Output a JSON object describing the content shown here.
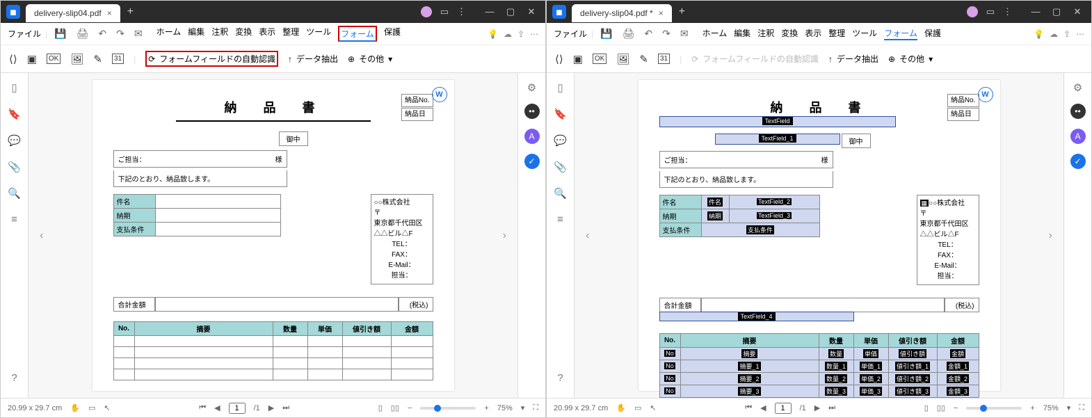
{
  "leftWindow": {
    "tab": {
      "title": "delivery-slip04.pdf"
    },
    "menubar": {
      "file": "ファイル",
      "items": [
        "ホーム",
        "編集",
        "注釈",
        "変換",
        "表示",
        "整理",
        "ツール"
      ],
      "form": "フォーム",
      "protect": "保護"
    },
    "toolbar": {
      "autorec": "フォームフィールドの自動認識",
      "extract": "データ抽出",
      "other": "その他"
    },
    "doc": {
      "title": "納　品　書",
      "nouhin_no": "納品No.",
      "nouhin_date": "納品日",
      "onchu": "御中",
      "tantou": "ご担当：",
      "sama": "様",
      "note": "下記のとおり、納品致します。",
      "kenmei": "件名",
      "nouki": "納期",
      "shiharai": "支払条件",
      "company": "○○株式会社",
      "postal": "〒",
      "addr1": "東京都千代田区",
      "addr2": "△△ビル△F",
      "tel": "TEL：",
      "fax": "FAX：",
      "email": "E-Mail：",
      "tantou2": "担当：",
      "total_label": "合計金額",
      "tax": "(税込)",
      "cols": {
        "no": "No.",
        "desc": "摘要",
        "qty": "数量",
        "price": "単価",
        "disc": "値引き額",
        "amount": "金額"
      }
    },
    "status": {
      "pagesize": "20.99 x 29.7 cm",
      "page": "1",
      "pages": "/1",
      "zoom": "75%"
    }
  },
  "rightWindow": {
    "tab": {
      "title": "delivery-slip04.pdf *"
    },
    "menubar": {
      "file": "ファイル",
      "items": [
        "ホーム",
        "編集",
        "注釈",
        "変換",
        "表示",
        "整理",
        "ツール"
      ],
      "form": "フォーム",
      "protect": "保護"
    },
    "toolbar": {
      "autorec": "フォームフィールドの自動認識",
      "extract": "データ抽出",
      "other": "その他"
    },
    "doc": {
      "title": "納　品　書",
      "nouhin_no": "納品No.",
      "nouhin_date": "納品日",
      "tf": "TextField",
      "tf1": "TextField_1",
      "onchu": "御中",
      "tantou": "ご担当：",
      "sama": "様",
      "note": "下記のとおり、納品致します。",
      "company": "○○株式会社",
      "postal": "〒",
      "addr1": "東京都千代田区",
      "addr2": "△△ビル△F",
      "tel": "TEL：",
      "fax": "FAX：",
      "email": "E-Mail：",
      "tantou2": "担当：",
      "kenmei": "件名",
      "nouki": "納期",
      "shiharai": "支払条件",
      "tf2": "TextField_2",
      "tf3": "TextField_3",
      "shiharai_f": "支払条件",
      "total_label": "合計金額",
      "tax": "(税込)",
      "tf4": "TextField_4",
      "cols": {
        "no": "No.",
        "desc": "摘要",
        "qty": "数量",
        "price": "単価",
        "disc": "値引き額",
        "amount": "金額"
      },
      "frows": [
        {
          "no": "No",
          "desc": "摘要",
          "qty": "数量",
          "price": "単価",
          "disc": "値引き額",
          "amount": "金額"
        },
        {
          "no": "No",
          "desc": "摘要_1",
          "qty": "数量_1",
          "price": "単価_1",
          "disc": "値引き額_1",
          "amount": "金額_1"
        },
        {
          "no": "No",
          "desc": "摘要_2",
          "qty": "数量_2",
          "price": "単価_2",
          "disc": "値引き額_2",
          "amount": "金額_2"
        },
        {
          "no": "No",
          "desc": "摘要_3",
          "qty": "数量_3",
          "price": "単価_3",
          "disc": "値引き額_3",
          "amount": "金額_3"
        }
      ]
    },
    "status": {
      "pagesize": "20.99 x 29.7 cm",
      "page": "1",
      "pages": "/1",
      "zoom": "75%"
    }
  }
}
